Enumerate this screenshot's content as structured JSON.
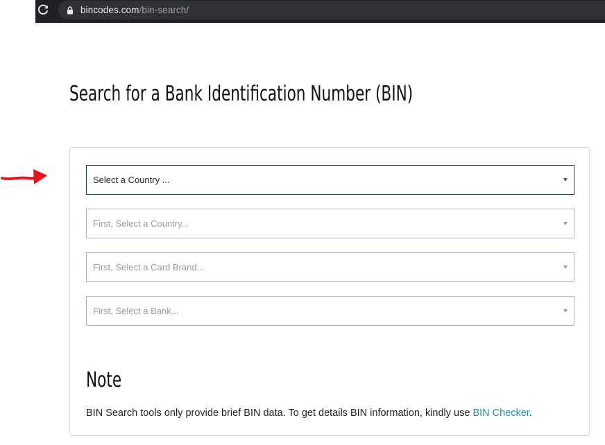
{
  "browser": {
    "url_domain": "bincodes.com",
    "url_path": "/bin-search/"
  },
  "page": {
    "title": "Search for a Bank Identification Number (BIN)"
  },
  "form": {
    "country_select": "Select a Country ...",
    "card_brand_select": "First, Select a Country...",
    "card_type_select": "First, Select a Card Brand...",
    "bank_select": "First, Select a Bank..."
  },
  "note": {
    "title": "Note",
    "text": "BIN Search tools only provide brief BIN data. To get details BIN information, kindly use ",
    "link_label": "BIN Checker",
    "text_end": "."
  },
  "colors": {
    "annotation": "#e8141b",
    "link": "#1a8fb0",
    "browser_bar": "#202124"
  }
}
